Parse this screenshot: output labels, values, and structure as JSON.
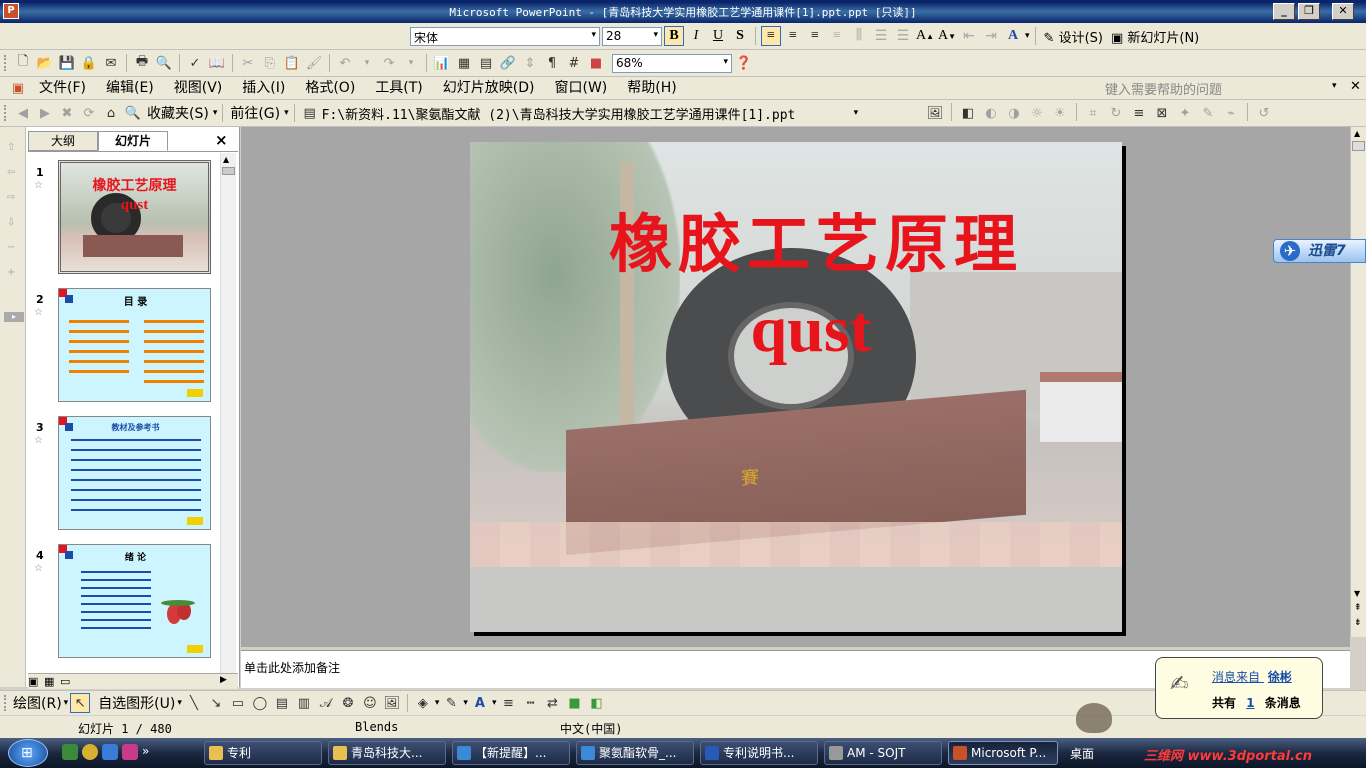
{
  "window": {
    "title": "Microsoft PowerPoint - [青岛科技大学实用橡胶工艺学通用课件[1].ppt.ppt [只读]]",
    "app_icon": "P"
  },
  "format_toolbar": {
    "font_name": "宋体",
    "font_size": "28",
    "bold": "B",
    "italic": "I",
    "underline": "U",
    "shadow": "S",
    "design_label": "设计(S)",
    "new_slide_label": "新幻灯片(N)"
  },
  "standard_toolbar": {
    "zoom": "68%"
  },
  "menu": {
    "items": [
      "文件(F)",
      "编辑(E)",
      "视图(V)",
      "插入(I)",
      "格式(O)",
      "工具(T)",
      "幻灯片放映(D)",
      "窗口(W)",
      "帮助(H)"
    ],
    "help_placeholder": "键入需要帮助的问题"
  },
  "web_toolbar": {
    "favorites": "收藏夹(S)",
    "goto": "前往(G)",
    "address": "F:\\新资料.11\\聚氨酯文献 (2)\\青岛科技大学实用橡胶工艺学通用课件[1].ppt"
  },
  "panel": {
    "tab_outline": "大纲",
    "tab_slides": "幻灯片",
    "close": "×"
  },
  "thumbs": [
    {
      "num": "1",
      "title": "橡胶工艺原理",
      "sub": "qust"
    },
    {
      "num": "2",
      "title": "目 录"
    },
    {
      "num": "3",
      "title": "教材及参考书"
    },
    {
      "num": "4",
      "title": "绪 论"
    }
  ],
  "slide": {
    "title": "橡胶工艺原理",
    "subtitle": "qust"
  },
  "notes": {
    "placeholder": "单击此处添加备注"
  },
  "draw_toolbar": {
    "draw": "绘图(R)",
    "autoshapes": "自选图形(U)"
  },
  "status": {
    "slide_pos": "幻灯片 1 / 480",
    "design": "Blends",
    "language": "中文(中国)"
  },
  "popup": {
    "from_label": "消息来自",
    "from_name": "徐彬",
    "count_prefix": "共有",
    "count": "1",
    "count_suffix": "条消息"
  },
  "xunlei": {
    "label": "迅雷7"
  },
  "taskbar": {
    "items": [
      "专利",
      "青岛科技大...",
      "【新提醒】...",
      "聚氨酯软骨_...",
      "专利说明书...",
      "AM - SOJT",
      "Microsoft P..."
    ],
    "desktop": "桌面",
    "watermark": "三维网 www.3dportal.cn"
  },
  "colors": {
    "title_red": "#e8141b",
    "thumb_bg": "#ccf5ff",
    "accent_blue": "#0a246a"
  }
}
